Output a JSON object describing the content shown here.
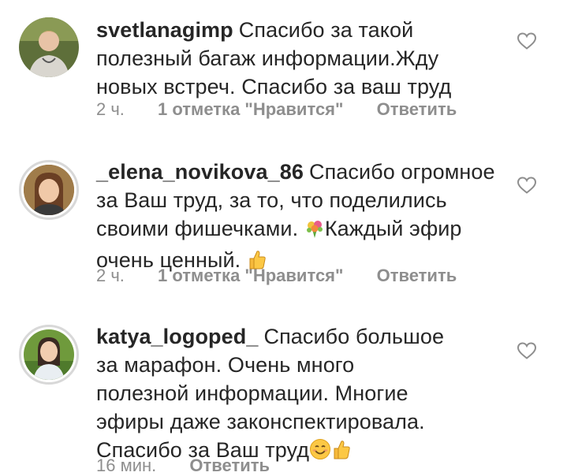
{
  "comments": [
    {
      "username": "svetlanagimp",
      "text": "Спасибо за такой полезный багаж информации.Жду новых встреч. Спасибо за ваш труд",
      "time": "2 ч.",
      "likes": "1 отметка \"Нравится\"",
      "reply": "Ответить"
    },
    {
      "username": "_elena_novikova_86",
      "text_part1": "Спасибо огромное за Ваш труд, за то, что поделились своими фишечками.",
      "text_part2": "Каждый эфир очень ценный.",
      "time": "2 ч.",
      "likes": "1 отметка \"Нравится\"",
      "reply": "Ответить"
    },
    {
      "username": "katya_logoped_",
      "text": "Спасибо большое за марафон. Очень много полезной информации. Многие эфиры даже законспектировала. Спасибо за Ваш труд",
      "time": "16 мин.",
      "reply": "Ответить"
    }
  ],
  "icons": {
    "like": "heart-outline-icon",
    "bouquet": "bouquet-emoji",
    "thumbs_up": "thumbs-up-emoji",
    "smile": "smiling-face-emoji"
  },
  "colors": {
    "text": "#262626",
    "secondary": "#8e8e8e"
  }
}
